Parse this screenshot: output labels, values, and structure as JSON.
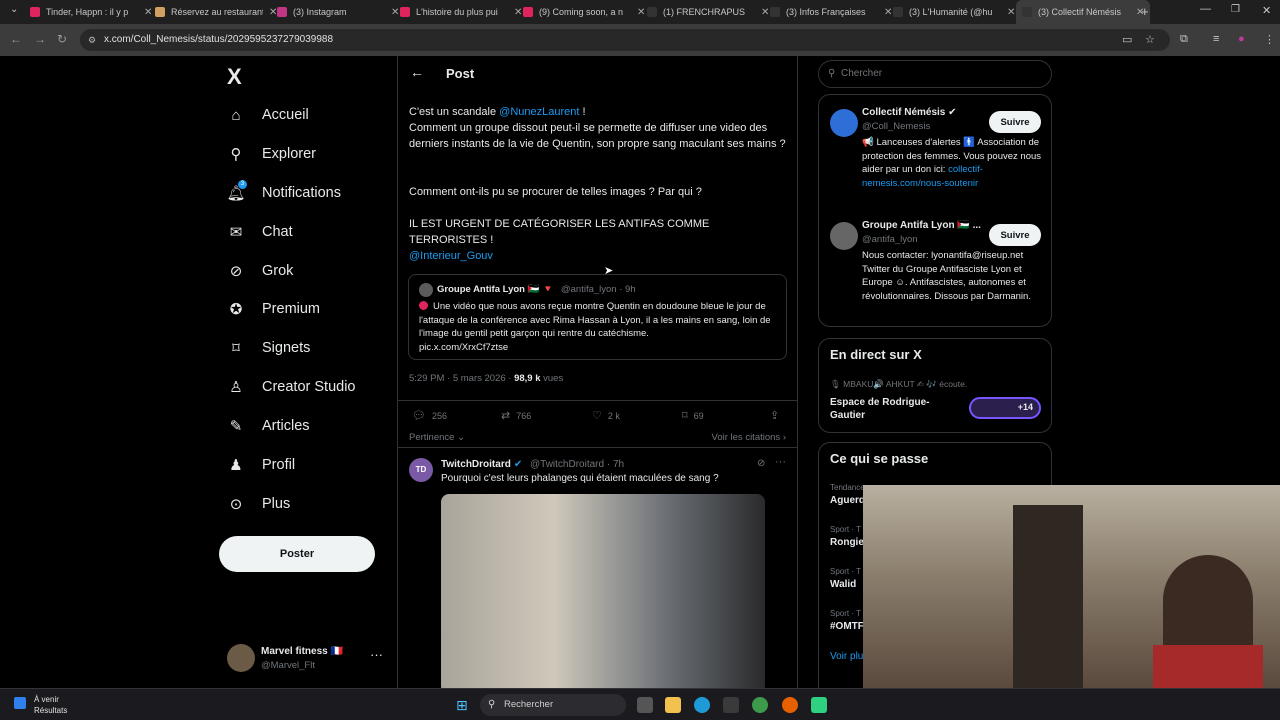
{
  "browser": {
    "tabs": [
      {
        "label": "Tinder, Happn : il y p",
        "color": "#e0245e"
      },
      {
        "label": "Réservez au restaurant",
        "color": "#d0a060"
      },
      {
        "label": "(3) Instagram",
        "color": "#c13584"
      },
      {
        "label": "L'histoire du plus pui",
        "color": "#e0245e"
      },
      {
        "label": "(9) Coming soon, a n",
        "color": "#e0245e"
      },
      {
        "label": "(1) FRENCHRAPUS",
        "color": "#333333"
      },
      {
        "label": "(3) Infos Françaises",
        "color": "#333333"
      },
      {
        "label": "(3) L'Humanité (@hu",
        "color": "#333333"
      },
      {
        "label": "(3) Collectif Némésis",
        "color": "#333333"
      }
    ],
    "url": "x.com/Coll_Nemesis/status/2029595237279039988"
  },
  "nav": {
    "logo": "X",
    "items": [
      {
        "label": "Accueil",
        "icon": "home-icon",
        "glyph": "⌂"
      },
      {
        "label": "Explorer",
        "icon": "search-icon",
        "glyph": "⚲"
      },
      {
        "label": "Notifications",
        "icon": "bell-icon",
        "glyph": "🔔︎"
      },
      {
        "label": "Chat",
        "icon": "mail-icon",
        "glyph": "✉"
      },
      {
        "label": "Grok",
        "icon": "grok-icon",
        "glyph": "⊘"
      },
      {
        "label": "Premium",
        "icon": "premium-icon",
        "glyph": "✪"
      },
      {
        "label": "Signets",
        "icon": "bookmark-icon",
        "glyph": "⌑"
      },
      {
        "label": "Creator Studio",
        "icon": "creator-icon",
        "glyph": "♙"
      },
      {
        "label": "Articles",
        "icon": "article-icon",
        "glyph": "✎"
      },
      {
        "label": "Profil",
        "icon": "profile-icon",
        "glyph": "♟"
      },
      {
        "label": "Plus",
        "icon": "more-icon",
        "glyph": "⊙"
      }
    ],
    "notif_badge": "3",
    "post_label": "Poster",
    "account": {
      "name": "Marvel fitness 🇫🇷",
      "handle": "@Marvel_Flt"
    }
  },
  "post": {
    "header": "Post",
    "line1_prefix": "C'est un scandale ",
    "line1_mention": "@NunezLaurent",
    "line1_suffix": " !",
    "paragraph": "Comment un groupe dissout peut-il se permette de diffuser une video des derniers instants de la vie de Quentin, son propre sang maculant ses mains ?",
    "question": "Comment ont-ils pu se procurer de telles images ? Par qui ?",
    "shout": "IL EST URGENT DE CATÉGORISER LES ANTIFAS COMME TERRORISTES !",
    "mention2": "@Interieur_Gouv",
    "quote": {
      "name": "Groupe Antifa Lyon 🇵🇸 🔻",
      "meta": "@antifa_lyon · 9h",
      "text": "Une vidéo que nous avons reçue montre Quentin en doudoune bleue le jour de l'attaque de la conférence avec Rima Hassan à Lyon, il a les mains en sang, loin de l'image du gentil petit garçon qui rentre du catéchisme.",
      "link": "pic.x.com/XrxCf7ztse"
    },
    "time": "5:29 PM · 5 mars 2026 · ",
    "views": "98,9 k",
    "views_suffix": " vues",
    "actions": {
      "replies": "256",
      "reposts": "766",
      "likes": "2 k",
      "bookmarks": "69"
    },
    "sort_label": "Pertinence",
    "quotes_link": "Voir les citations"
  },
  "reply": {
    "avatar": "TD",
    "name": "TwitchDroitard",
    "meta": "@TwitchDroitard · 7h",
    "text": "Pourquoi c'est leurs phalanges qui étaient maculées de sang ?"
  },
  "right": {
    "search_placeholder": "Chercher",
    "accounts": [
      {
        "name": "Collectif Némésis ✔",
        "handle": "@Coll_Nemesis",
        "bio": "📢 Lanceuses d'alertes 🚹 Association de protection des femmes. Vous pouvez nous aider par un don ici: ",
        "bio_link": "collectif-nemesis.com/nous-soutenir",
        "follow": "Suivre",
        "color": "#2d6fd6"
      },
      {
        "name": "Groupe Antifa Lyon 🇵🇸 ...",
        "handle": "@antifa_lyon",
        "bio": "Nous contacter: lyonantifa@riseup.net Twitter du Groupe Antifasciste Lyon et Europe ☺. Antifascistes, autonomes et révolutionnaires. Dissous par Darmanin.",
        "bio_link": "",
        "follow": "Suivre",
        "color": "#666666"
      }
    ],
    "live": {
      "title": "En direct sur X",
      "hosts": "🎙 MBAKU🔊 AHKUT ✍ 🎶 écoute.",
      "space": "Espace de Rodrigue-Gautier",
      "count": "+14"
    },
    "trends": {
      "title": "Ce qui se passe",
      "items": [
        {
          "cat": "Tendance",
          "title": "Aguerd"
        },
        {
          "cat": "Sport · T",
          "title": "Rongie"
        },
        {
          "cat": "Sport · T",
          "title": "Walid"
        },
        {
          "cat": "Sport · T",
          "title": "#OMTF"
        }
      ],
      "more": "Voir plu"
    }
  },
  "taskbar": {
    "weather_title": "À venir",
    "weather_sub": "Résultats",
    "search": "Rechercher"
  }
}
